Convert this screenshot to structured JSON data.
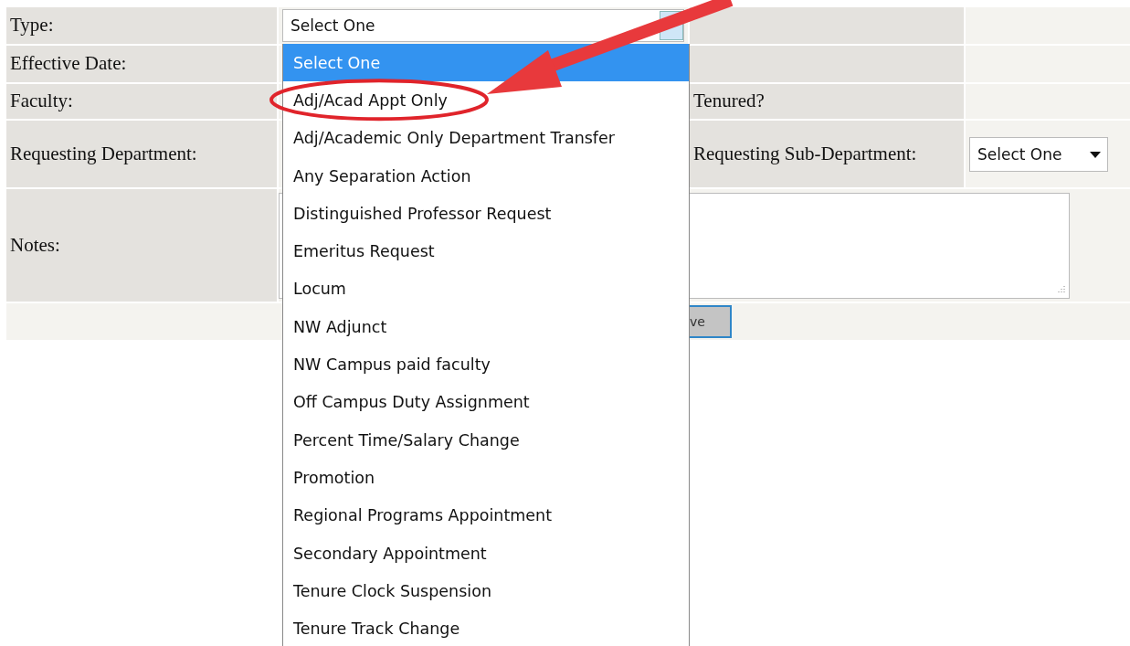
{
  "form": {
    "rows": [
      {
        "label": "Type:",
        "field": {
          "kind": "select",
          "value": "Select One"
        }
      },
      {
        "label": "Effective Date:"
      },
      {
        "label": "Faculty:",
        "side_label": "Tenured?"
      },
      {
        "label": "Requesting Department:",
        "side_label": "Requesting Sub-Department:",
        "side_field": {
          "kind": "select",
          "value": "Select One"
        }
      },
      {
        "label": "Notes:",
        "field": {
          "kind": "textarea"
        }
      }
    ],
    "button": "ve"
  },
  "dropdown": {
    "options": [
      {
        "label": "Select One",
        "selected": true,
        "circled": false
      },
      {
        "label": "Adj/Acad Appt Only",
        "selected": false,
        "circled": true
      },
      {
        "label": "Adj/Academic Only Department Transfer",
        "selected": false,
        "circled": false
      },
      {
        "label": "Any Separation Action",
        "selected": false,
        "circled": false
      },
      {
        "label": "Distinguished Professor Request",
        "selected": false,
        "circled": false
      },
      {
        "label": "Emeritus Request",
        "selected": false,
        "circled": false
      },
      {
        "label": "Locum",
        "selected": false,
        "circled": false
      },
      {
        "label": "NW Adjunct",
        "selected": false,
        "circled": false
      },
      {
        "label": "NW Campus paid faculty",
        "selected": false,
        "circled": false
      },
      {
        "label": "Off Campus Duty Assignment",
        "selected": false,
        "circled": false
      },
      {
        "label": "Percent Time/Salary Change",
        "selected": false,
        "circled": false
      },
      {
        "label": "Promotion",
        "selected": false,
        "circled": false
      },
      {
        "label": "Regional Programs Appointment",
        "selected": false,
        "circled": false
      },
      {
        "label": "Secondary Appointment",
        "selected": false,
        "circled": false
      },
      {
        "label": "Tenure Clock Suspension",
        "selected": false,
        "circled": false
      },
      {
        "label": "Tenure Track Change",
        "selected": false,
        "circled": false
      }
    ]
  }
}
